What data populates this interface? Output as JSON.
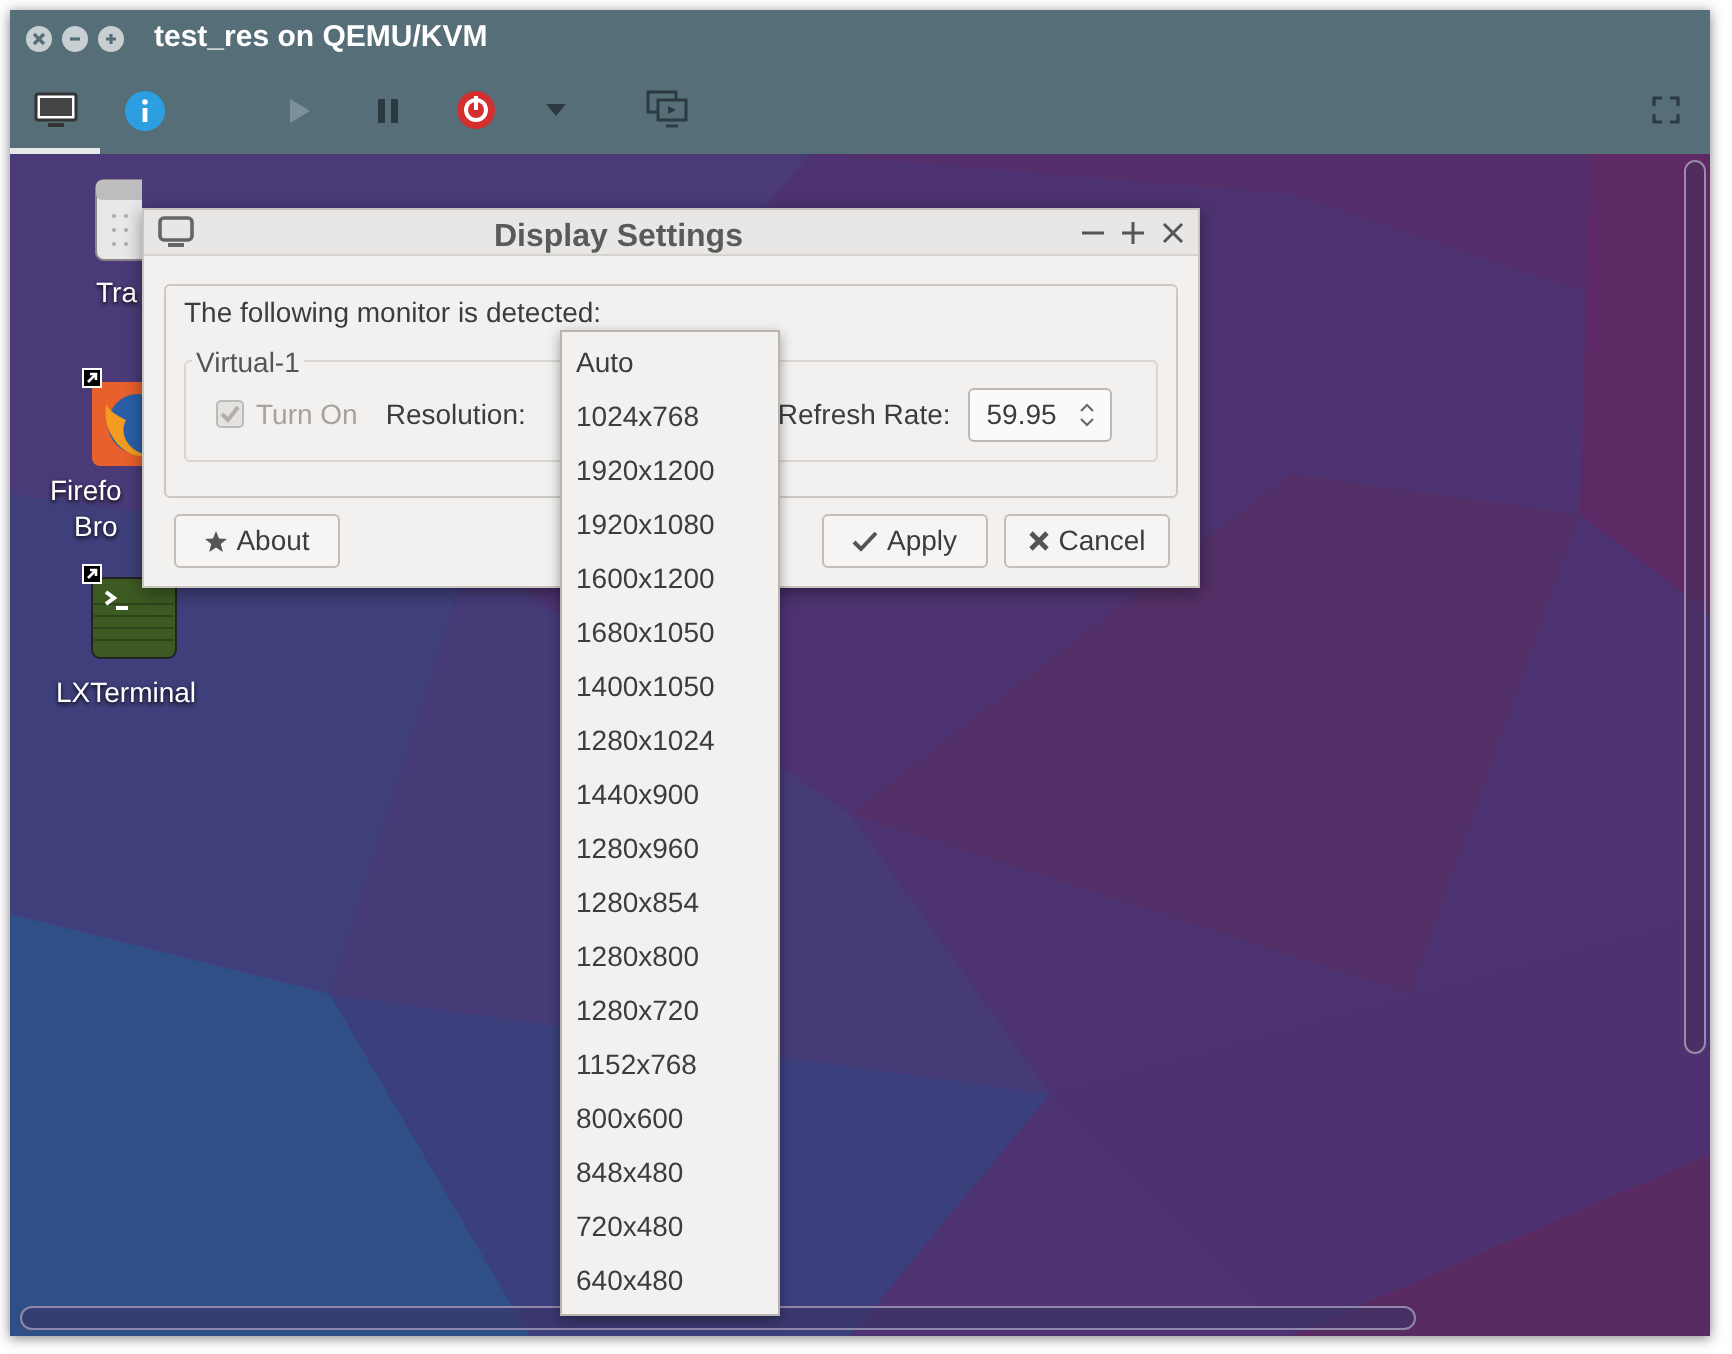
{
  "window": {
    "title": "test_res on QEMU/KVM"
  },
  "view_tabs": [
    {
      "kind": "display",
      "selected": true
    },
    {
      "kind": "info",
      "selected": false
    }
  ],
  "controls": [
    {
      "kind": "play",
      "disabled": true
    },
    {
      "kind": "pause",
      "disabled": false
    },
    {
      "kind": "power",
      "disabled": false
    },
    {
      "kind": "menu",
      "disabled": false
    },
    {
      "kind": "screens",
      "disabled": false
    }
  ],
  "desktop_icons": [
    {
      "kind": "trash",
      "shortcut": false,
      "label_lines": [
        "Tra"
      ]
    },
    {
      "kind": "firefox",
      "shortcut": true,
      "label_lines": [
        "Firefo",
        "Bro"
      ]
    },
    {
      "kind": "terminal",
      "shortcut": true,
      "label_lines": [
        "LXTerminal"
      ]
    }
  ],
  "dialog": {
    "title": "Display Settings",
    "message": "The following monitor is detected:",
    "group_title": "Virtual-1",
    "turn_on": {
      "label": "Turn On",
      "checked": true,
      "disabled": true
    },
    "resolution_label": "Resolution:",
    "refresh_label": "Refresh Rate:",
    "refresh_value": "59.95",
    "buttons": [
      {
        "kind": "about",
        "label": "About"
      },
      {
        "kind": "apply",
        "label": "Apply"
      },
      {
        "kind": "cancel",
        "label": "Cancel"
      }
    ]
  },
  "resolution_menu": {
    "options": [
      "Auto",
      "1024x768",
      "1920x1200",
      "1920x1080",
      "1600x1200",
      "1680x1050",
      "1400x1050",
      "1280x1024",
      "1440x900",
      "1280x960",
      "1280x854",
      "1280x800",
      "1280x720",
      "1152x768",
      "800x600",
      "848x480",
      "720x480",
      "640x480"
    ]
  }
}
